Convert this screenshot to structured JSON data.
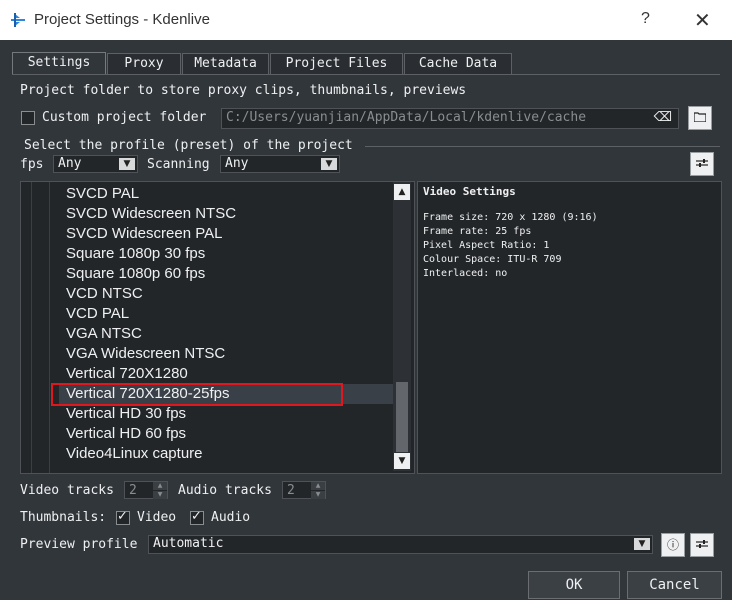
{
  "window": {
    "title": "Project Settings - Kdenlive",
    "help_glyph": "?",
    "close_glyph": "✕"
  },
  "tabs": [
    {
      "label": "Settings"
    },
    {
      "label": "Proxy"
    },
    {
      "label": "Metadata"
    },
    {
      "label": "Project Files"
    },
    {
      "label": "Cache Data"
    }
  ],
  "folder": {
    "description": "Project folder to store proxy clips, thumbnails, previews",
    "custom_label": "Custom project folder",
    "path_value": "C:/Users/yuanjian/AppData/Local/kdenlive/cache",
    "custom_checked": false
  },
  "profile": {
    "group_label": "Select the profile (preset) of the project",
    "fps_label": "fps",
    "fps_value": "Any",
    "scanning_label": "Scanning",
    "scanning_value": "Any",
    "items": [
      "SVCD PAL",
      "SVCD Widescreen NTSC",
      "SVCD Widescreen PAL",
      "Square 1080p 30 fps",
      "Square 1080p 60 fps",
      "VCD NTSC",
      "VCD PAL",
      "VGA NTSC",
      "VGA Widescreen NTSC",
      "Vertical 720X1280",
      "Vertical 720X1280-25fps",
      "Vertical HD 30 fps",
      "Vertical HD 60 fps",
      "Video4Linux capture"
    ],
    "selected_index": 10
  },
  "video_settings": {
    "header": "Video Settings",
    "rows": [
      "Frame size: 720 x 1280 (9:16)",
      "Frame rate: 25 fps",
      "Pixel Aspect Ratio: 1",
      "Colour Space: ITU-R 709",
      "Interlaced: no"
    ]
  },
  "tracks": {
    "video_label": "Video tracks",
    "video_value": "2",
    "audio_label": "Audio tracks",
    "audio_value": "2"
  },
  "thumbnails": {
    "label": "Thumbnails:",
    "video_label": "Video",
    "video_checked": true,
    "audio_label": "Audio",
    "audio_checked": true
  },
  "preview": {
    "label": "Preview profile",
    "value": "Automatic"
  },
  "buttons": {
    "ok": "OK",
    "cancel": "Cancel"
  },
  "colors": {
    "background": "#31363b",
    "highlight_box": "#e0171e",
    "selection": "#3a4048"
  }
}
